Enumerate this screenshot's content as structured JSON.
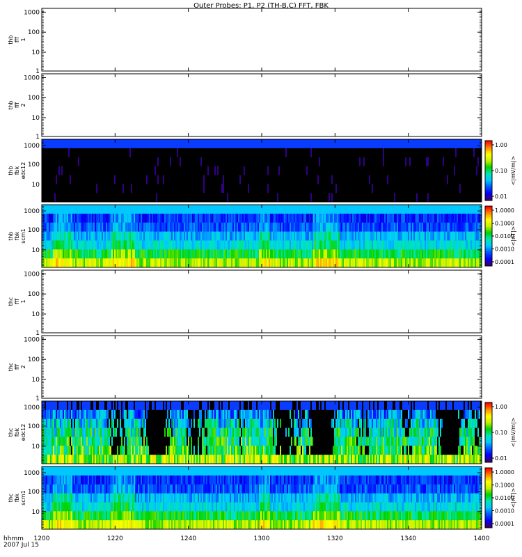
{
  "title": "Outer Probes: P1, P2 (TH-B,C) FFT, FBK",
  "time_axis": {
    "ticks": [
      "1200",
      "1220",
      "1240",
      "1300",
      "1320",
      "1340",
      "1400"
    ],
    "label_top": "hhmm",
    "label_bottom": "2007 Jul 15"
  },
  "chart_data": [
    {
      "type": "heatmap",
      "id": "thb_fff1",
      "ylabel": [
        "thb",
        "fff",
        "1"
      ],
      "y_ticks": [
        "1000",
        "100",
        "10",
        "1"
      ],
      "ylim": [
        1,
        2048
      ],
      "y_scale": "log",
      "has_data": false
    },
    {
      "type": "heatmap",
      "id": "thb_fff2",
      "ylabel": [
        "thb",
        "fff",
        "2"
      ],
      "y_ticks": [
        "1000",
        "100",
        "10",
        "1"
      ],
      "ylim": [
        1,
        2048
      ],
      "y_scale": "log",
      "has_data": false
    },
    {
      "type": "heatmap",
      "id": "thb_fbk_edc12",
      "ylabel": [
        "thb",
        "fbk",
        "edc12"
      ],
      "y_ticks": [
        "1000",
        "100",
        "10"
      ],
      "y_scale": "log",
      "has_data": true,
      "pattern": "fbk_e_quiet",
      "colorbar": {
        "ticks": [
          "1.00",
          "0.10",
          "0.01"
        ],
        "label": "<|mV/m|>"
      }
    },
    {
      "type": "heatmap",
      "id": "thb_fbk_scm1",
      "ylabel": [
        "thb",
        "fbk",
        "scm1"
      ],
      "y_ticks": [
        "1000",
        "100",
        "10"
      ],
      "y_scale": "log",
      "has_data": true,
      "pattern": "fbk_b",
      "colorbar": {
        "ticks": [
          "1.0000",
          "0.1000",
          "0.0100",
          "0.0010",
          "0.0001"
        ],
        "label": "<|nT|>"
      }
    },
    {
      "type": "heatmap",
      "id": "thc_fff1",
      "ylabel": [
        "thc",
        "fff",
        "1"
      ],
      "y_ticks": [
        "1000",
        "100",
        "10",
        "1"
      ],
      "ylim": [
        1,
        2048
      ],
      "y_scale": "log",
      "has_data": false
    },
    {
      "type": "heatmap",
      "id": "thc_fff2",
      "ylabel": [
        "thc",
        "fff",
        "2"
      ],
      "y_ticks": [
        "1000",
        "100",
        "10",
        "1"
      ],
      "ylim": [
        1,
        2048
      ],
      "y_scale": "log",
      "has_data": false
    },
    {
      "type": "heatmap",
      "id": "thc_fbk_edc12",
      "ylabel": [
        "thc",
        "fbk",
        "edc12"
      ],
      "y_ticks": [
        "1000",
        "100",
        "10"
      ],
      "y_scale": "log",
      "has_data": true,
      "pattern": "fbk_e_active",
      "colorbar": {
        "ticks": [
          "1.00",
          "0.10",
          "0.01"
        ],
        "label": "<|mV/m|>"
      }
    },
    {
      "type": "heatmap",
      "id": "thc_fbk_scm1",
      "ylabel": [
        "thc",
        "fbk",
        "scm1"
      ],
      "y_ticks": [
        "1000",
        "100",
        "10"
      ],
      "y_scale": "log",
      "has_data": true,
      "pattern": "fbk_b",
      "colorbar": {
        "ticks": [
          "1.0000",
          "0.1000",
          "0.0100",
          "0.0010",
          "0.0001"
        ],
        "label": "<|nT|>"
      }
    }
  ]
}
